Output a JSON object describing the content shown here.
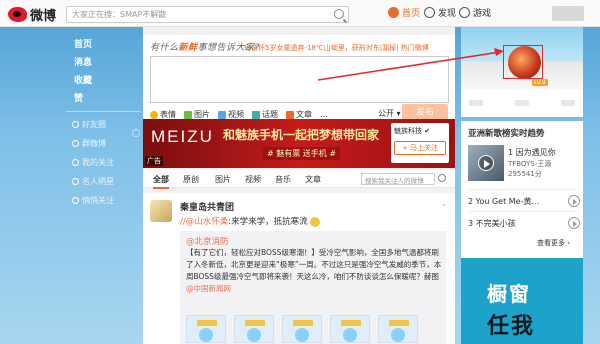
{
  "topbar": {
    "logo_text": "微博",
    "search_placeholder": "大家正在搜：SMAP不解散",
    "nav": [
      {
        "label": "首页",
        "icon": "home-icon",
        "color": "#e86c28"
      },
      {
        "label": "发现",
        "icon": "discover-icon",
        "color": "#333333"
      },
      {
        "label": "游戏",
        "icon": "game-icon",
        "color": "#333333"
      }
    ]
  },
  "sidebar": {
    "main_items": [
      "首页",
      "消息",
      "收藏",
      "赞"
    ],
    "groups": [
      "好友圈",
      "群微博",
      "我的关注",
      "名人明星",
      "悄悄关注"
    ]
  },
  "publisher": {
    "prompt_pre": "有什么",
    "prompt_hl": "新鲜",
    "prompt_post": "事想告诉大家?",
    "hot": "母亲怀5岁女童遗弃-18℃山坳里，获刑对东|漏掉|  热门微博",
    "tools": [
      {
        "label": "表情",
        "icon": "emoji-icon",
        "color": "#f5b800"
      },
      {
        "label": "图片",
        "icon": "image-icon",
        "color": "#6bbd3a"
      },
      {
        "label": "视频",
        "icon": "video-icon",
        "color": "#5aa7e0"
      },
      {
        "label": "话题",
        "icon": "topic-icon",
        "color": "#3db0a6"
      },
      {
        "label": "文章",
        "icon": "article-icon",
        "color": "#e86c28"
      }
    ],
    "more": "…",
    "scope": "公开 ▾",
    "send": "发布"
  },
  "ad": {
    "brand": "MEIZU",
    "slogan": "和魅族手机一起把梦想带回家",
    "sub": "# 魅有票 送手机 #",
    "tag": "广告",
    "card_name": "魅族科技 ✔",
    "card_follow": "+ 马上关注"
  },
  "tabs": {
    "items": [
      "全部",
      "原创",
      "图片",
      "视频",
      "音乐",
      "文章"
    ],
    "search_placeholder": "搜索我关注人的微博"
  },
  "post": {
    "author": "秦皇岛共青团",
    "chevron": "⌄",
    "text_at": "//@山水怀柔",
    "text_body": ":来学来学，抵抗寒流",
    "repost_author": "@北京消防",
    "repost_text_pre": "【有了它们，轻松应对BOSS级寒潮！】受冷空气影响，全国多地气温都将刷了入冬新低，北京更是迎来“极寒”一周。不过这只是强冷空气发威的季节，本周BOSS级最强冷空气即将来袭！天这么冷，咱们不防谈谈怎么保暖呢？赫图",
    "repost_text_hl": "@中国新闻网"
  },
  "right": {
    "profile_badge": "LV.9",
    "rank_title": "亚洲新歌榜实时趋势",
    "songs": [
      {
        "rank": "1",
        "title": "因为遇见你",
        "artist": "TFBOYS-王源",
        "count": "295541分"
      },
      {
        "rank": "2",
        "title": "You Get Me-黄..."
      },
      {
        "rank": "3",
        "title": "不完美小孩"
      }
    ],
    "more": "查看更多 ›",
    "ad2_line1": "橱窗",
    "ad2_line2": "任我"
  },
  "colors": {
    "accent": "#e86c28",
    "highlight_box": "#e5262e"
  }
}
